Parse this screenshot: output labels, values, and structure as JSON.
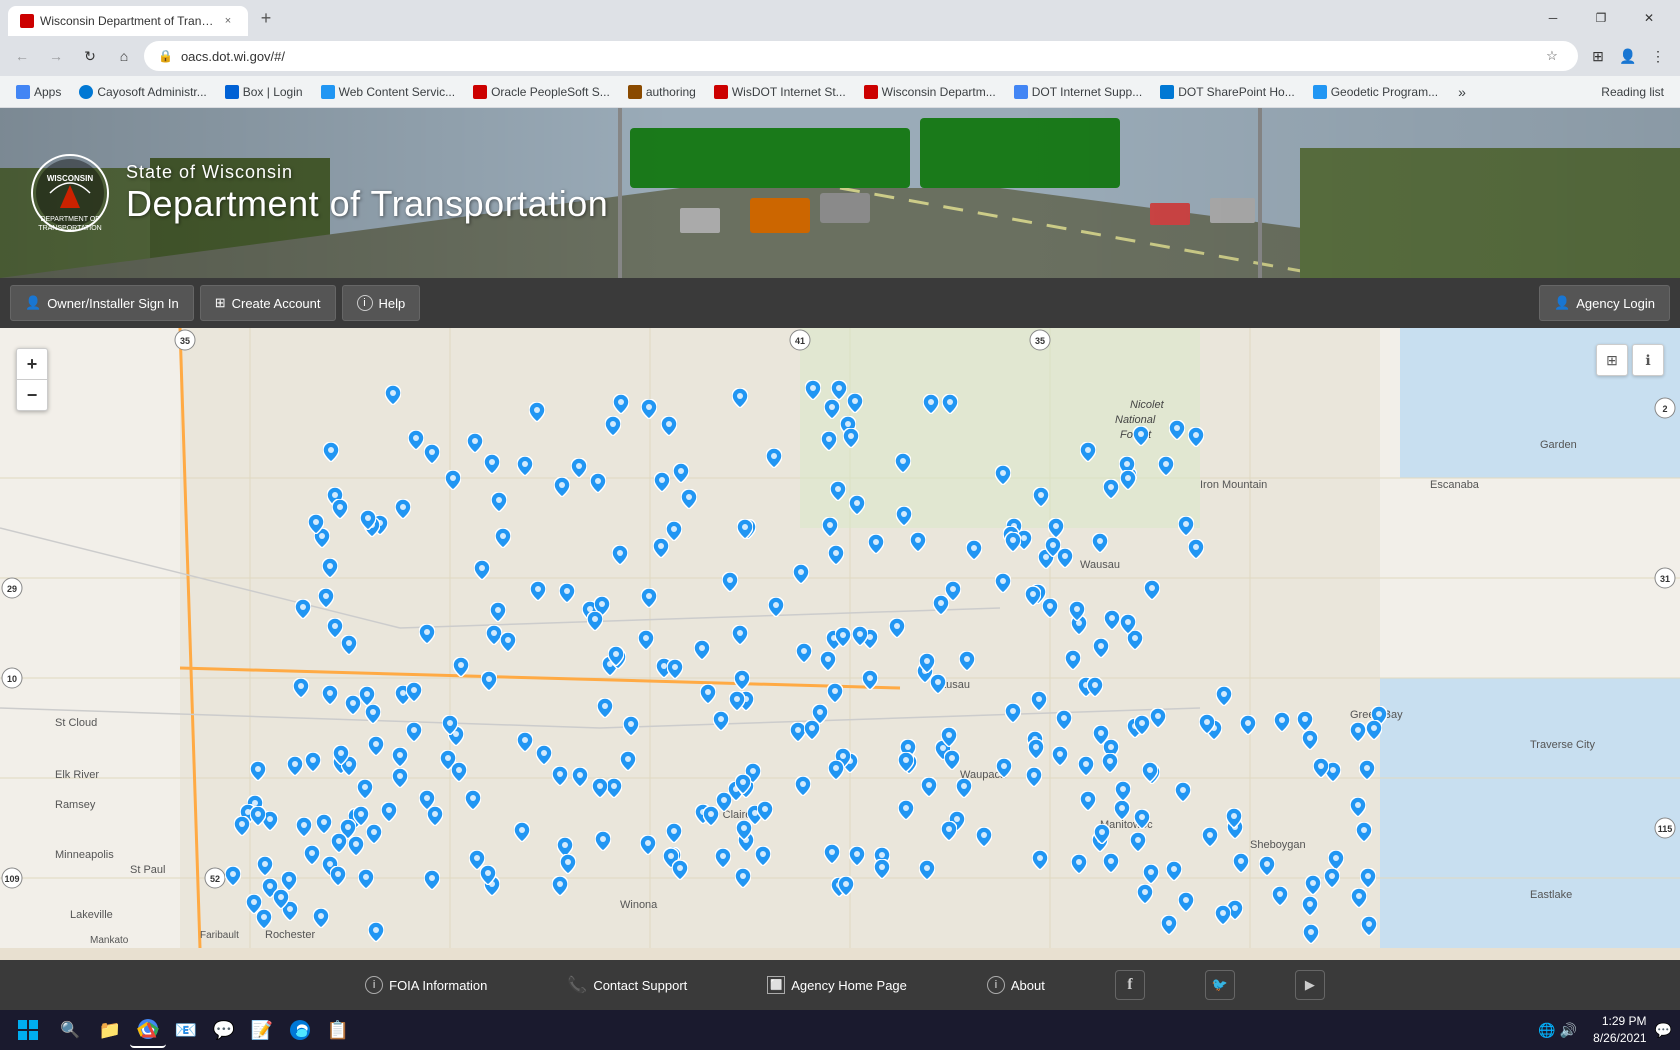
{
  "browser": {
    "tab": {
      "favicon_color": "#cc3300",
      "title": "Wisconsin Department of Transp...",
      "close_label": "×"
    },
    "new_tab_label": "+",
    "window_controls": {
      "minimize": "─",
      "maximize": "❐",
      "close": "✕"
    },
    "address": {
      "lock_icon": "🔒",
      "url": "oacs.dot.wi.gov/#/",
      "star_icon": "☆",
      "profile_icon": "👤",
      "more_icon": "⋮"
    },
    "nav": {
      "back": "←",
      "forward": "→",
      "reload": "↻",
      "home": "⌂",
      "extensions": "⊞",
      "profile": "👤",
      "more": "⋮"
    }
  },
  "bookmarks": {
    "items": [
      {
        "label": "Apps",
        "icon_color": "#4285f4"
      },
      {
        "label": "Cayosoft Administr...",
        "icon_color": "#0078d4"
      },
      {
        "label": "Box | Login",
        "icon_color": "#0061d5"
      },
      {
        "label": "Web Content Servic...",
        "icon_color": "#2196f3"
      },
      {
        "label": "Oracle PeopleSoft S...",
        "icon_color": "#cc0000"
      },
      {
        "label": "authoring",
        "icon_color": "#8a4a00"
      },
      {
        "label": "WisDOT Internet St...",
        "icon_color": "#cc0000"
      },
      {
        "label": "Wisconsin Departm...",
        "icon_color": "#cc0000"
      },
      {
        "label": "DOT Internet Supp...",
        "icon_color": "#4285f4"
      },
      {
        "label": "DOT SharePoint Ho...",
        "icon_color": "#0078d4"
      },
      {
        "label": "Geodetic Program...",
        "icon_color": "#2196f3"
      }
    ],
    "more_label": "»",
    "reading_list_label": "Reading list"
  },
  "header": {
    "org_state": "State of Wisconsin",
    "org_dept": "Department of Transportation",
    "logo_alt": "WisDOT Logo"
  },
  "navbar": {
    "owner_sign_in_label": "Owner/Installer Sign In",
    "create_account_label": "Create Account",
    "help_label": "Help",
    "agency_login_label": "Agency Login",
    "owner_icon": "👤",
    "create_icon": "⊞",
    "help_icon": "ℹ",
    "agency_icon": "👤"
  },
  "map": {
    "zoom_in": "+",
    "zoom_out": "−",
    "grid_icon": "⊞",
    "info_icon": "ℹ",
    "labels": [
      "St Cloud",
      "Elk River",
      "Ramsey",
      "Minneapolis",
      "St Paul",
      "Lakeville",
      "Faribault",
      "Mankato",
      "Rochester",
      "Escanaba",
      "Garden",
      "Iron Mountain",
      "Traverse City",
      "Eastlake",
      "Green Bay",
      "Sheboygan",
      "Wausau",
      "Nicolet National Forest"
    ],
    "pin_count": 300
  },
  "footer": {
    "foia_label": "FOIA Information",
    "contact_label": "Contact Support",
    "agency_home_label": "Agency Home Page",
    "about_label": "About",
    "foia_icon": "i",
    "contact_phone_icon": "📞",
    "agency_home_icon": "⬜",
    "about_icon": "i",
    "facebook_icon": "f",
    "twitter_icon": "🐦",
    "youtube_icon": "▶"
  },
  "taskbar": {
    "start_icon": "⊞",
    "search_icon": "🔍",
    "time": "1:29 PM",
    "date": "8/26/2021",
    "apps": [
      {
        "name": "file-explorer",
        "icon": "📁"
      },
      {
        "name": "chrome",
        "icon": "🌐",
        "active": true
      },
      {
        "name": "outlook",
        "icon": "📧"
      },
      {
        "name": "skype",
        "icon": "💬"
      },
      {
        "name": "word",
        "icon": "📝"
      },
      {
        "name": "edge",
        "icon": "🔷"
      },
      {
        "name": "app6",
        "icon": "📋"
      }
    ]
  }
}
